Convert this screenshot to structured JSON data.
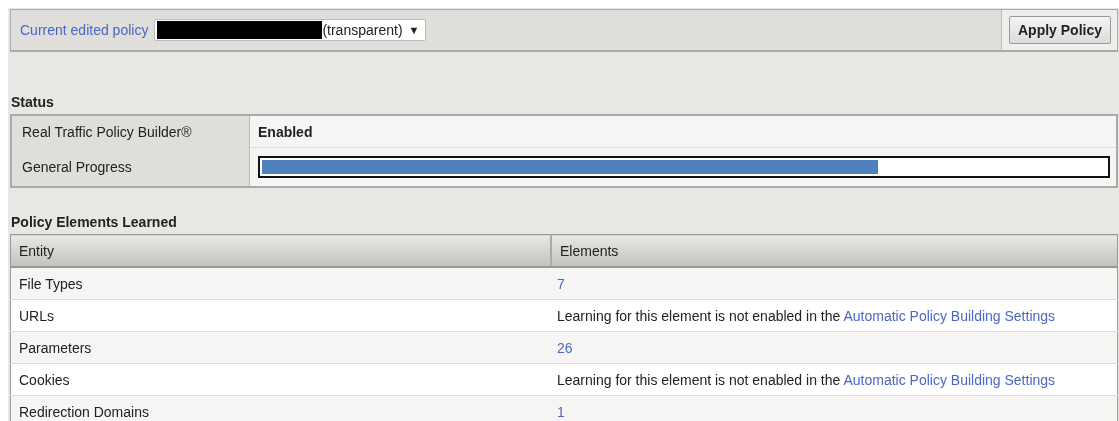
{
  "policy_bar": {
    "label": "Current edited policy",
    "policy_select": {
      "value": "(transparent)",
      "arrow": "▼"
    },
    "apply_button": "Apply Policy"
  },
  "status": {
    "title": "Status",
    "rows": [
      {
        "kind": "text",
        "label": "Real Traffic Policy Builder®",
        "value": "Enabled"
      },
      {
        "kind": "progress",
        "label": "General Progress",
        "level": 0.73
      }
    ]
  },
  "learned": {
    "title": "Policy Elements Learned",
    "columns": [
      "Entity",
      "Elements"
    ],
    "rows": [
      {
        "entity": "File Types",
        "elements": {
          "kind": "count",
          "text": "7"
        }
      },
      {
        "entity": "URLs",
        "elements": {
          "kind": "message",
          "text": "Learning for this element is not enabled in the",
          "link": "Automatic Policy Building Settings"
        }
      },
      {
        "entity": "Parameters",
        "elements": {
          "kind": "count",
          "text": "26"
        }
      },
      {
        "entity": "Cookies",
        "elements": {
          "kind": "message",
          "text": "Learning for this element is not enabled in the",
          "link": "Automatic Policy Building Settings"
        }
      },
      {
        "entity": "Redirection Domains",
        "elements": {
          "kind": "count",
          "text": "1"
        }
      }
    ]
  }
}
